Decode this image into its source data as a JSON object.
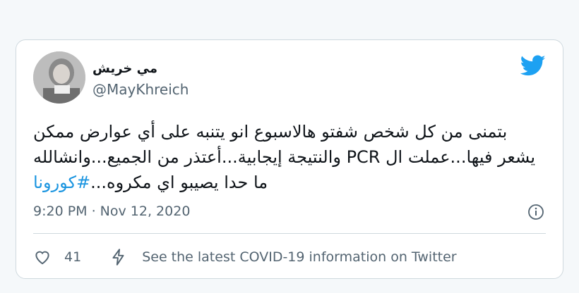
{
  "tweet": {
    "display_name": "مي خريش",
    "handle": "@MayKhreich",
    "text_main": "بتمنى من كل شخص شفتو هالاسبوع انو يتنبه على أي عوارض ممكن يشعر فيها...عملت ال PCR والنتيجة إيجابية...أعتذر من الجميع...وانشالله ما حدا يصيبو اي مكروه...",
    "hashtag": "#كورونا",
    "timestamp": "9:20 PM · Nov 12, 2020",
    "like_count": "41",
    "covid_info": "See the latest COVID-19 information on Twitter"
  },
  "icons": {
    "brand": "twitter-bird-icon",
    "info": "info-icon",
    "like": "heart-icon",
    "covid": "lightning-icon"
  },
  "colors": {
    "accent": "#1da1f2",
    "hashtag": "#1b95e0",
    "muted": "#536471",
    "text": "#0f1419"
  }
}
